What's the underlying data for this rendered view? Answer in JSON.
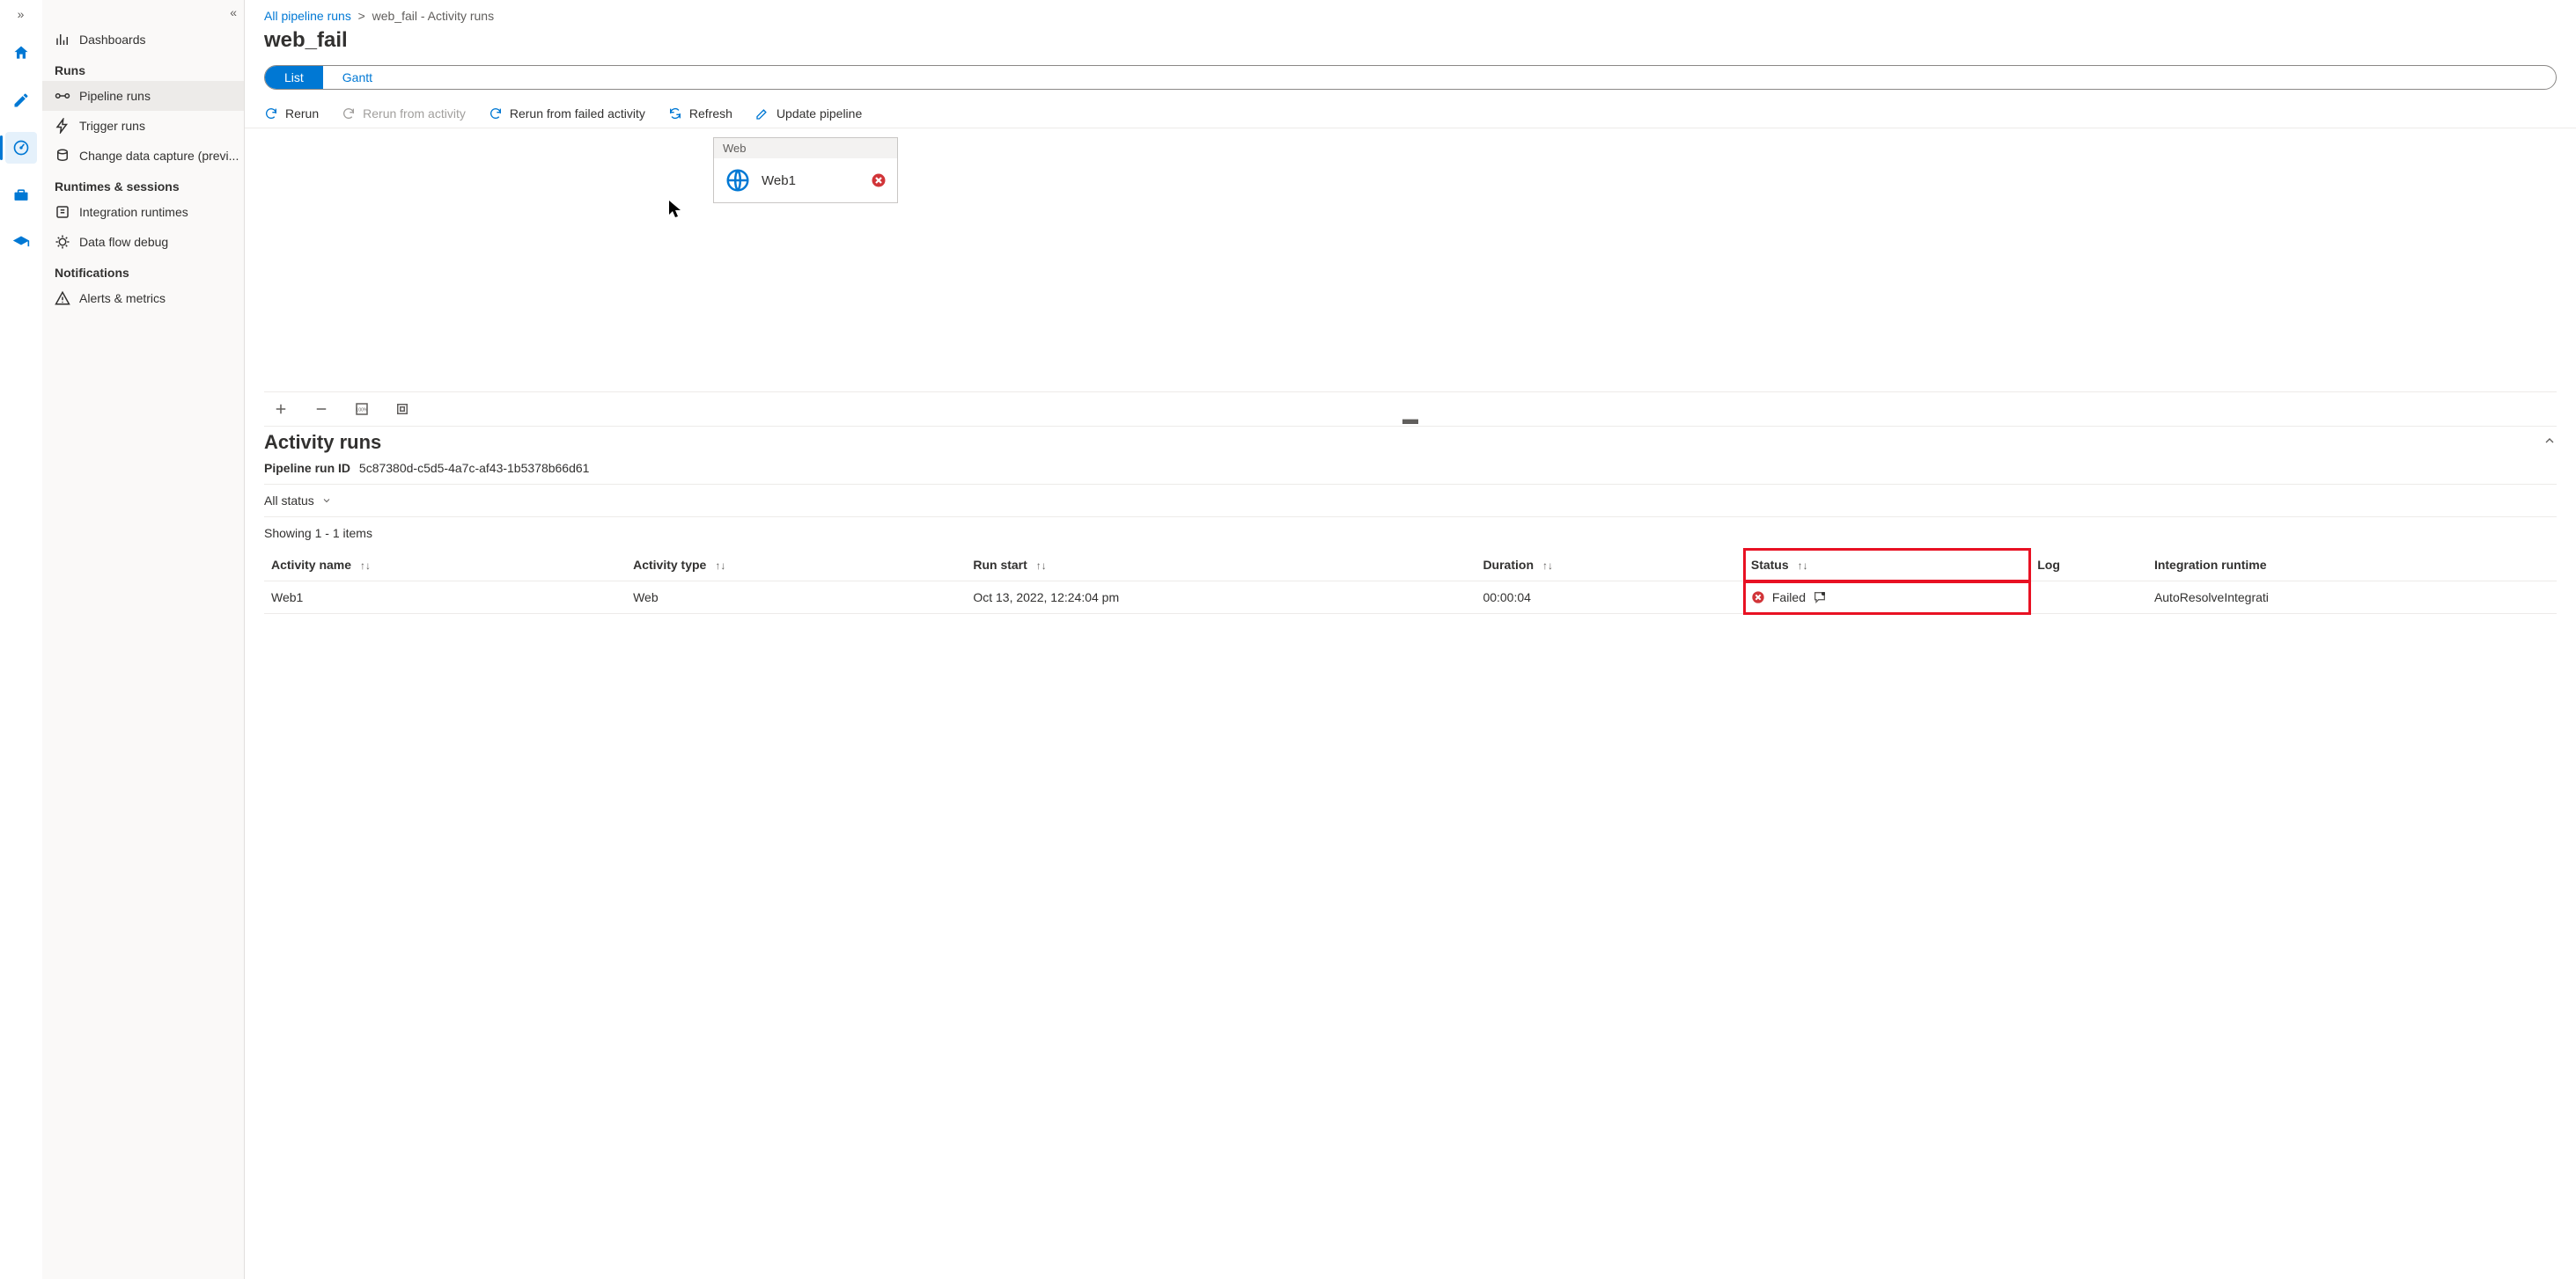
{
  "rail": {
    "items": [
      "home",
      "author",
      "monitor",
      "manage",
      "learn"
    ]
  },
  "sidebar": {
    "top_item": "Dashboards",
    "sections": {
      "runs": {
        "header": "Runs",
        "items": [
          "Pipeline runs",
          "Trigger runs",
          "Change data capture (previ..."
        ]
      },
      "runtimes": {
        "header": "Runtimes & sessions",
        "items": [
          "Integration runtimes",
          "Data flow debug"
        ]
      },
      "notifications": {
        "header": "Notifications",
        "items": [
          "Alerts & metrics"
        ]
      }
    }
  },
  "breadcrumb": {
    "root": "All pipeline runs",
    "leaf": "web_fail - Activity runs"
  },
  "page_title": "web_fail",
  "toggle": {
    "list": "List",
    "gantt": "Gantt"
  },
  "commands": {
    "rerun": "Rerun",
    "rerun_from_activity": "Rerun from activity",
    "rerun_from_failed": "Rerun from failed activity",
    "refresh": "Refresh",
    "update_pipeline": "Update pipeline"
  },
  "activity_card": {
    "type": "Web",
    "name": "Web1"
  },
  "runs": {
    "title": "Activity runs",
    "run_id_label": "Pipeline run ID",
    "run_id": "5c87380d-c5d5-4a7c-af43-1b5378b66d61",
    "status_filter": "All status",
    "showing": "Showing 1 - 1 items",
    "columns": [
      "Activity name",
      "Activity type",
      "Run start",
      "Duration",
      "Status",
      "Log",
      "Integration runtime"
    ],
    "rows": [
      {
        "name": "Web1",
        "type": "Web",
        "start": "Oct 13, 2022, 12:24:04 pm",
        "duration": "00:00:04",
        "status": "Failed",
        "log": "",
        "runtime": "AutoResolveIntegrati"
      }
    ]
  }
}
